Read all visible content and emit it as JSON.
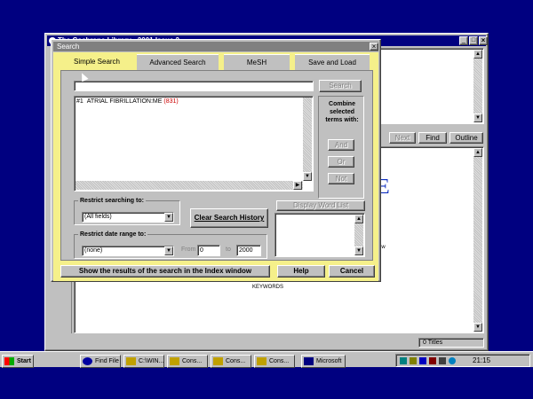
{
  "colors": {
    "desktop": "#000080",
    "dialog": "#f5f08a",
    "accent": "#cc0000",
    "titlebar": "#000080"
  },
  "app_window": {
    "title": "The Cochrane Library - 2001 Issue 2",
    "min": "_",
    "max": "□",
    "close": "×"
  },
  "app_toolbar": {
    "next_label": "Next",
    "find_label": "Find",
    "outline_label": "Outline",
    "big_letter": "E",
    "body_text_1": "ew",
    "body_text_2": "KEYWORDS"
  },
  "dialog": {
    "title": "Search",
    "close": "×",
    "tabs": [
      "Simple Search",
      "Advanced Search",
      "MeSH",
      "Save and Load"
    ],
    "search_input": {
      "value": "",
      "placeholder": ""
    },
    "search_button": "Search",
    "history": [
      {
        "num": "#1",
        "term": "ATRIAL FIBRILLATION:ME",
        "count": "(831)"
      }
    ],
    "combine_label": "Combine selected terms with:",
    "and_button": "And",
    "or_button": "Or",
    "not_button": "Not",
    "restrict_search_label": "Restrict searching to:",
    "restrict_search_value": "(All fields)",
    "clear_history_button": "Clear Search History",
    "display_words_button": "Display Word List",
    "restrict_date_label": "Restrict date range to:",
    "restrict_date_value": "(none)",
    "from_label": "From",
    "from_value": "0",
    "to_label": "to",
    "to_value": "2000",
    "show_results_button": "Show the results of the search in the Index window",
    "help_button": "Help",
    "cancel_button": "Cancel"
  },
  "statusbar": {
    "text": "0 Titles"
  },
  "taskbar": {
    "start": "Start",
    "items": [
      "Find File",
      "C:\\WIN...",
      "Cons...",
      "Cons...",
      "Cons...",
      "Microsoft"
    ],
    "clock": "21:15"
  }
}
